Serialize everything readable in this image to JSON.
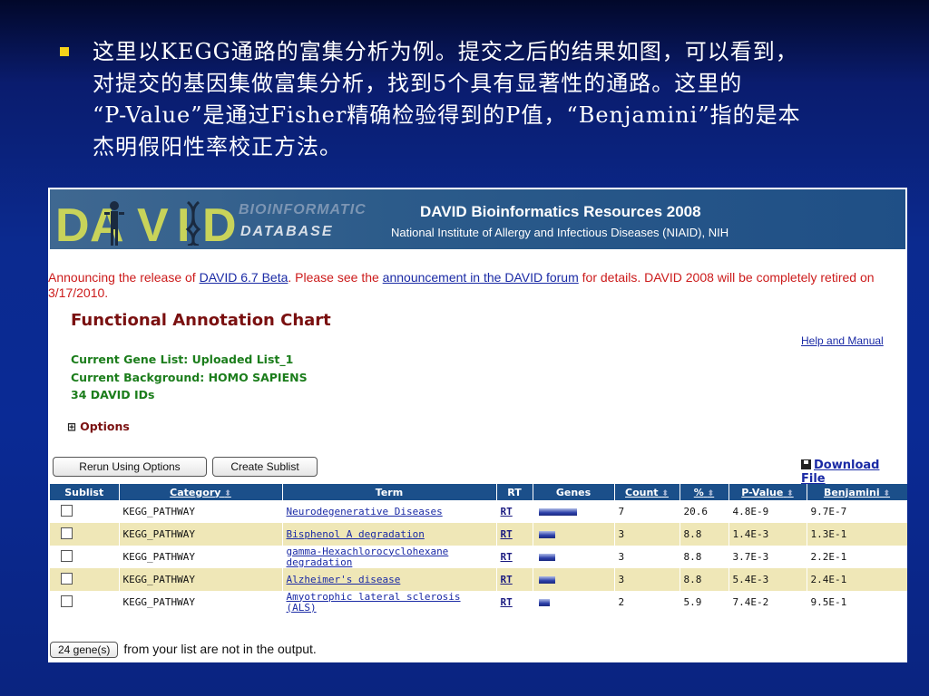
{
  "slide": {
    "lines": [
      "这里以KEGG通路的富集分析为例。提交之后的结果如图，可以看到，",
      "对提交的基因集做富集分析，找到5个具有显著性的通路。这里的",
      "“P-Value”是通过Fisher精确检验得到的P值，“Benjamini”指的是本",
      "杰明假阳性率校正方法。"
    ]
  },
  "banner": {
    "logo_letters": [
      "D",
      "A",
      "V",
      "I",
      "D"
    ],
    "bio_text": "BIOINFORMATIC",
    "db_text": "DATABASE",
    "title": "DAVID Bioinformatics Resources 2008",
    "subtitle": "National Institute of Allergy and Infectious Diseases (NIAID), NIH"
  },
  "announcement": {
    "part1": "Announcing the release of ",
    "link1": "DAVID 6.7 Beta",
    "part2": ". Please see the ",
    "link2": "announcement in the DAVID forum",
    "part3": " for details. DAVID 2008 will be completely retired on 3/17/2010."
  },
  "page_title": "Functional Annotation Chart",
  "help_link": "Help and Manual",
  "gene_list": "Current Gene List: Uploaded List_1",
  "background": "Current Background: HOMO SAPIENS",
  "david_ids": "34 DAVID IDs",
  "options_label": "Options",
  "buttons": {
    "rerun": "Rerun Using Options",
    "create_sublist": "Create Sublist",
    "download": "Download File"
  },
  "table": {
    "headers": [
      "Sublist",
      "Category",
      "Term",
      "RT",
      "Genes",
      "Count",
      "%",
      "P-Value",
      "Benjamini"
    ],
    "rows": [
      {
        "category": "KEGG_PATHWAY",
        "term": "Neurodegenerative Diseases",
        "rt": "RT",
        "count": "7",
        "percent": "20.6",
        "pvalue": "4.8E-9",
        "benjamini": "9.7E-7",
        "gene_fraction": 1.0
      },
      {
        "category": "KEGG_PATHWAY",
        "term": "Bisphenol A degradation",
        "rt": "RT",
        "count": "3",
        "percent": "8.8",
        "pvalue": "1.4E-3",
        "benjamini": "1.3E-1",
        "gene_fraction": 0.43
      },
      {
        "category": "KEGG_PATHWAY",
        "term": "gamma-Hexachlorocyclohexane degradation",
        "rt": "RT",
        "count": "3",
        "percent": "8.8",
        "pvalue": "3.7E-3",
        "benjamini": "2.2E-1",
        "gene_fraction": 0.43
      },
      {
        "category": "KEGG_PATHWAY",
        "term": "Alzheimer's disease",
        "rt": "RT",
        "count": "3",
        "percent": "8.8",
        "pvalue": "5.4E-3",
        "benjamini": "2.4E-1",
        "gene_fraction": 0.43
      },
      {
        "category": "KEGG_PATHWAY",
        "term": "Amyotrophic lateral sclerosis (ALS)",
        "rt": "RT",
        "count": "2",
        "percent": "5.9",
        "pvalue": "7.4E-2",
        "benjamini": "9.5E-1",
        "gene_fraction": 0.29
      }
    ]
  },
  "footer": {
    "button": "24 gene(s)",
    "text": "from your list are not in the output."
  },
  "colors": {
    "banner": "#2c5b8a",
    "header_row": "#1b4f8a",
    "alt_row": "#efe7b7",
    "announce": "#cc1b1b",
    "title": "#7a1010",
    "gene_info": "#1b7d1b"
  }
}
